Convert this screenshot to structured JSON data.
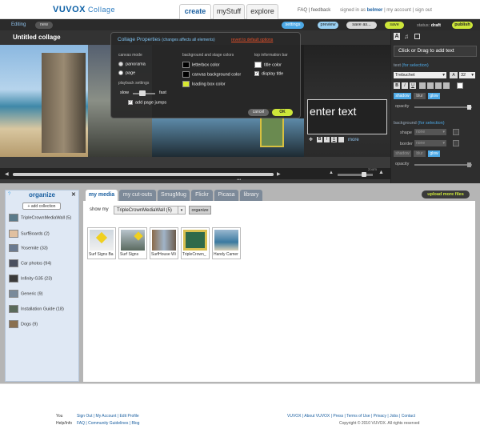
{
  "header": {
    "logo": "VUVOX",
    "logo_sub": "Collage",
    "tabs": [
      {
        "label": "create"
      },
      {
        "label": "myStuff"
      },
      {
        "label": "explore"
      }
    ],
    "links": "FAQ | feedback",
    "signed_in_prefix": "signed in as",
    "user": "belmer",
    "account_links": "| my account | sign out"
  },
  "editor_bar": {
    "editing": "Editing",
    "new": "new",
    "settings": "settings",
    "preview": "preview",
    "save_as": "save as...",
    "save": "save",
    "status_label": "status:",
    "status_value": "draft",
    "publish": "publish"
  },
  "collage": {
    "title": "Untitled collage",
    "text_placeholder": "enter text",
    "more": "more",
    "zoom_label": "zoom"
  },
  "popup": {
    "title": "Collage Properties",
    "subtitle": "(changes affects all elements)",
    "revert": "revert to default options",
    "canvas_mode": "canvas mode",
    "panorama": "panorama",
    "page": "page",
    "playback_settings": "playback settings",
    "slow": "slow",
    "fast": "fast",
    "add_page_jumps": "add page jumps",
    "bg_header": "background and stage colors",
    "letterbox_color": "letterbox color",
    "canvas_bg_color": "canvas background color",
    "loading_box_color": "loading box color",
    "info_header": "top information bar",
    "title_color": "title color",
    "display_title": "display title",
    "cancel": "cancel",
    "ok": "OK",
    "colors": {
      "letterbox": "#000000",
      "canvas_bg": "#000000",
      "loading": "#d8e830",
      "title": "#ffffff"
    }
  },
  "right_panel": {
    "hint": "Click or Drag to add text",
    "text_label": "text",
    "text_for": "(for selection)",
    "font": "Trebuchet",
    "size": "32",
    "shadow": "shadow",
    "blur": "blur",
    "glow": "glow",
    "opacity": "opacity",
    "background_label": "background",
    "background_for": "(for selection)",
    "shape": "shape",
    "border": "border",
    "none": "none",
    "opacity2": "opacity"
  },
  "organize": {
    "title": "organize",
    "add_collection": "+ add collection",
    "items": [
      {
        "label": "TripleCrownMediaWall (5)"
      },
      {
        "label": "SurfBoards (2)"
      },
      {
        "label": "Yosemite (33)"
      },
      {
        "label": "Car photos (94)"
      },
      {
        "label": "Infinity G35 (23)"
      },
      {
        "label": "Generic (9)"
      },
      {
        "label": "Installation Guide (18)"
      },
      {
        "label": "Dogs (9)"
      }
    ]
  },
  "media": {
    "tabs": [
      {
        "label": "my media"
      },
      {
        "label": "my cut-outs"
      },
      {
        "label": "SmugMug"
      },
      {
        "label": "Flickr"
      },
      {
        "label": "Picasa"
      },
      {
        "label": "library"
      }
    ],
    "upload": "upload more files",
    "show_my": "show my",
    "selected": "TripleCrownMediaWall (5)",
    "organize_btn": "organize",
    "thumbs": [
      {
        "caption": "Surf Signs Ba"
      },
      {
        "caption": "Surf Signs"
      },
      {
        "caption": "SurfHouse Wi"
      },
      {
        "caption": "TripleCrown_"
      },
      {
        "caption": "Handy Camer"
      }
    ]
  },
  "footer": {
    "you": "You",
    "help": "Help/Info",
    "you_links": "Sign Out | My Account | Edit Profile",
    "help_links": "FAQ | Community Guidelines | Blog",
    "brand_links": "VUVOX | About VUVOX | Press | Terms of Use | Privacy | Jobs | Contact",
    "copyright": "Copyright © 2010 VUVOX. All rights reserved"
  }
}
